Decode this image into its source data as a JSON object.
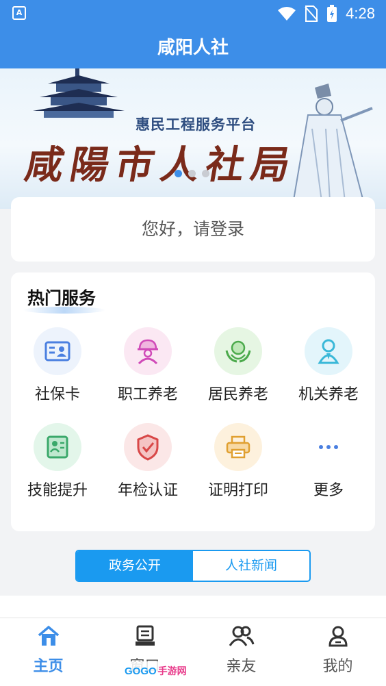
{
  "status_bar": {
    "time": "4:28",
    "app_indicator": "A",
    "icons": [
      "wifi-icon",
      "no-sim-icon",
      "battery-charging-icon"
    ]
  },
  "header": {
    "title": "咸阳人社"
  },
  "banner": {
    "subtitle": "惠民工程服务平台",
    "calligraphy": "咸陽市人社局",
    "slide_count": 3,
    "active_slide": 1
  },
  "login": {
    "prompt": "您好，请登录"
  },
  "hot_services": {
    "title": "热门服务",
    "items": [
      {
        "label": "社保卡",
        "icon": "id-card-icon",
        "color": "#4a7fe0"
      },
      {
        "label": "职工养老",
        "icon": "worker-helmet-icon",
        "color": "#d04ab8"
      },
      {
        "label": "居民养老",
        "icon": "hands-heart-icon",
        "color": "#4caa4c"
      },
      {
        "label": "机关养老",
        "icon": "official-person-icon",
        "color": "#3ab8d8"
      },
      {
        "label": "技能提升",
        "icon": "skill-certificate-icon",
        "color": "#3aa86a"
      },
      {
        "label": "年检认证",
        "icon": "shield-check-icon",
        "color": "#d84848"
      },
      {
        "label": "证明打印",
        "icon": "printer-icon",
        "color": "#e0a030"
      },
      {
        "label": "更多",
        "icon": "more-dots-icon",
        "color": "#4a7fe0"
      }
    ]
  },
  "news_tabs": {
    "items": [
      {
        "label": "政务公开",
        "active": true
      },
      {
        "label": "人社新闻",
        "active": false
      }
    ]
  },
  "bottom_nav": {
    "items": [
      {
        "label": "主页",
        "icon": "home-icon",
        "active": true
      },
      {
        "label": "窗口",
        "icon": "window-icon",
        "active": false
      },
      {
        "label": "亲友",
        "icon": "friends-icon",
        "active": false
      },
      {
        "label": "我的",
        "icon": "profile-icon",
        "active": false
      }
    ]
  },
  "watermark": {
    "logo": "GOGO",
    "text": "手游网"
  },
  "colors": {
    "primary": "#3d8ee8",
    "tab_accent": "#1a9af0"
  }
}
